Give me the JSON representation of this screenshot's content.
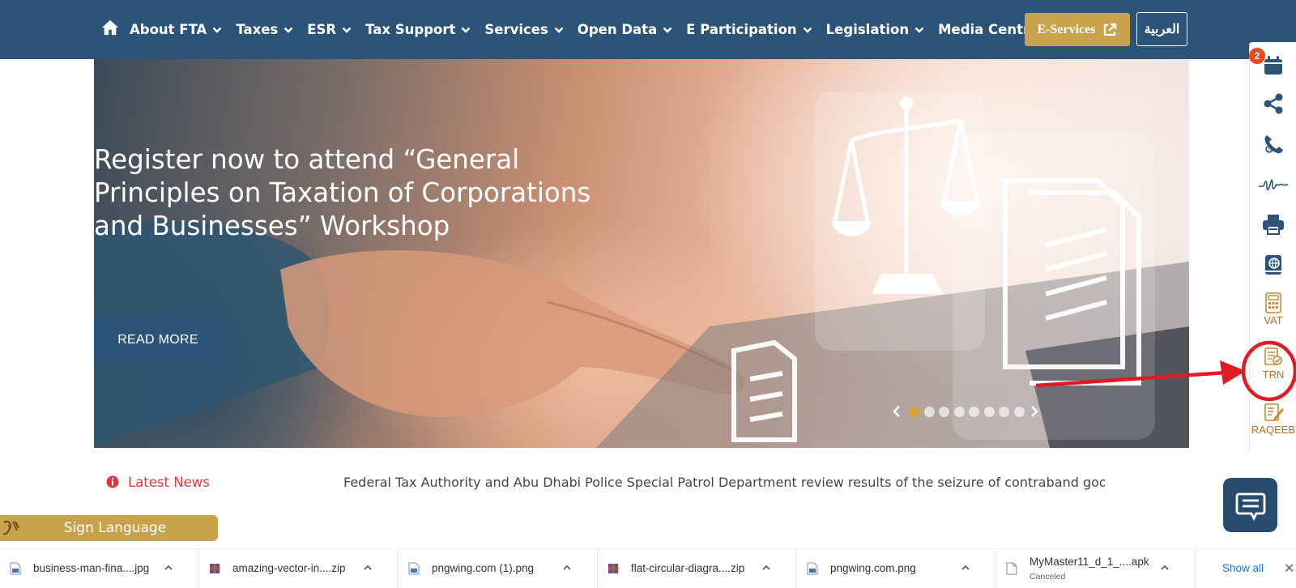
{
  "nav": {
    "items": [
      {
        "label": "About FTA"
      },
      {
        "label": "Taxes"
      },
      {
        "label": "ESR"
      },
      {
        "label": "Tax Support"
      },
      {
        "label": "Services"
      },
      {
        "label": "Open Data"
      },
      {
        "label": "E Participation"
      },
      {
        "label": "Legislation"
      },
      {
        "label": "Media Centre"
      }
    ],
    "eservices_label": "E-Services",
    "arabic_label": "العربية"
  },
  "hero": {
    "title_lines": [
      "Register now to attend “General",
      "Principles on Taxation of Corporations",
      "and Businesses” Workshop"
    ],
    "read_more": "READ MORE",
    "slide_count": 8,
    "active_slide": 1
  },
  "sidebar": {
    "calendar_badge": "2",
    "items": [
      {
        "icon": "calendar-icon"
      },
      {
        "icon": "share-icon"
      },
      {
        "icon": "support-call-icon"
      },
      {
        "icon": "signature-icon"
      },
      {
        "icon": "printer-icon"
      },
      {
        "icon": "guide-book-icon"
      },
      {
        "icon": "calculator-icon",
        "label": "VAT"
      },
      {
        "icon": "trn-verify-icon",
        "label": "TRN"
      },
      {
        "icon": "raqeeb-icon",
        "label": "RAQEEB"
      }
    ]
  },
  "news": {
    "label": "Latest News",
    "ticker": "Federal Tax Authority and Abu Dhabi Police Special Patrol Department review results of the seizure of contraband goods"
  },
  "sign_language": {
    "label": "Sign Language"
  },
  "downloads": {
    "items": [
      {
        "name": "business-man-fina....jpg",
        "type": "image"
      },
      {
        "name": "amazing-vector-in....zip",
        "type": "zip"
      },
      {
        "name": "pngwing.com (1).png",
        "type": "image"
      },
      {
        "name": "flat-circular-diagra....zip",
        "type": "zip"
      },
      {
        "name": "pngwing.com.png",
        "type": "image"
      },
      {
        "name": "MyMaster11_d_1_....apk",
        "type": "file",
        "status": "Canceled"
      }
    ],
    "show_all": "Show all"
  },
  "colors": {
    "nav_bg": "#2b5478",
    "gold": "#c9a24d",
    "news_red": "#e0363f",
    "sidebar_icon": "#2b5478",
    "sidebar_label": "#b4731f",
    "annotation_red": "#e01b24"
  }
}
